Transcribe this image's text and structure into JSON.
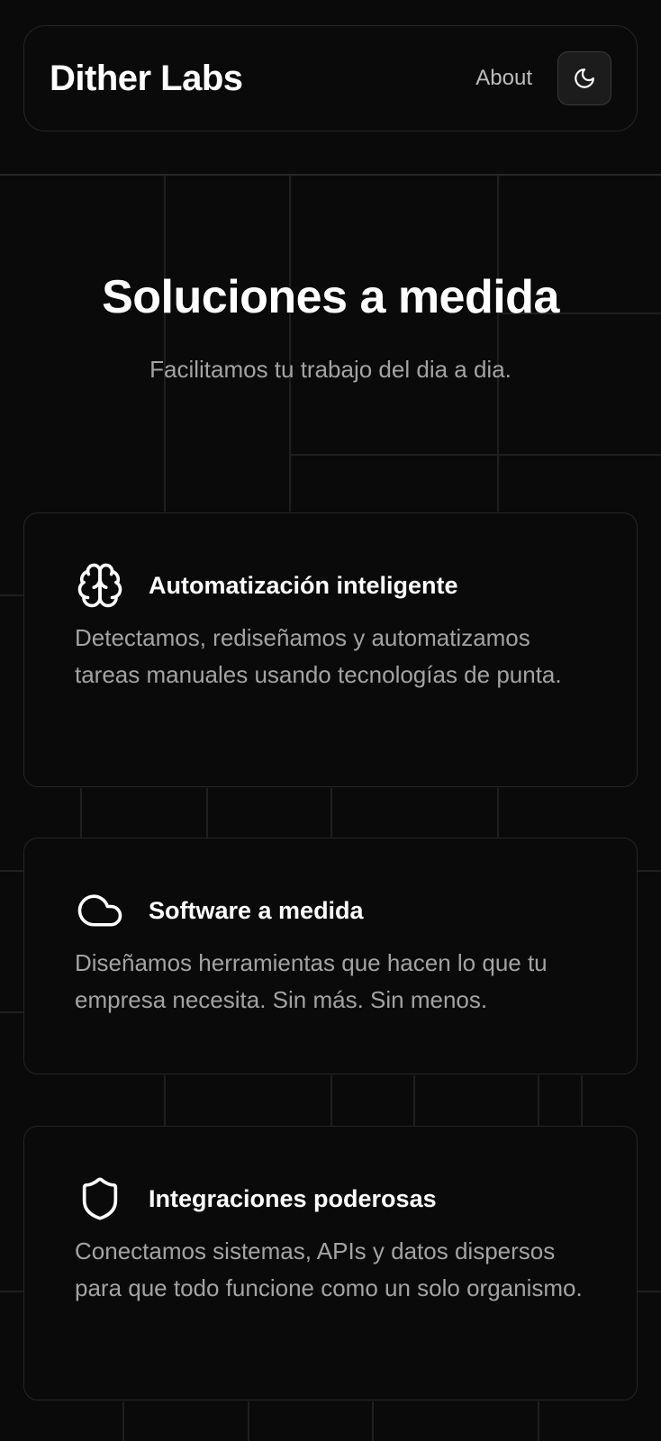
{
  "header": {
    "brand": "Dither Labs",
    "nav_about": "About",
    "theme_icon": "moon-icon"
  },
  "hero": {
    "title": "Soluciones a medida",
    "subtitle": "Facilitamos tu trabajo del dia a dia."
  },
  "features": [
    {
      "icon": "brain-icon",
      "title": "Automatización inteligente",
      "description": "Detectamos, rediseñamos y automatizamos tareas manuales usando tecnologías de punta."
    },
    {
      "icon": "cloud-icon",
      "title": "Software a medida",
      "description": "Diseñamos herramientas que hacen lo que tu empresa necesita. Sin más. Sin menos."
    },
    {
      "icon": "shield-icon",
      "title": "Integraciones poderosas",
      "description": "Conectamos sistemas, APIs y datos dispersos para que todo funcione como un solo organismo."
    }
  ],
  "colors": {
    "background": "#0a0a0a",
    "border": "#262626",
    "grid_line": "#1f1f1f",
    "text_primary": "#ffffff",
    "text_muted": "#a3a3a3"
  }
}
